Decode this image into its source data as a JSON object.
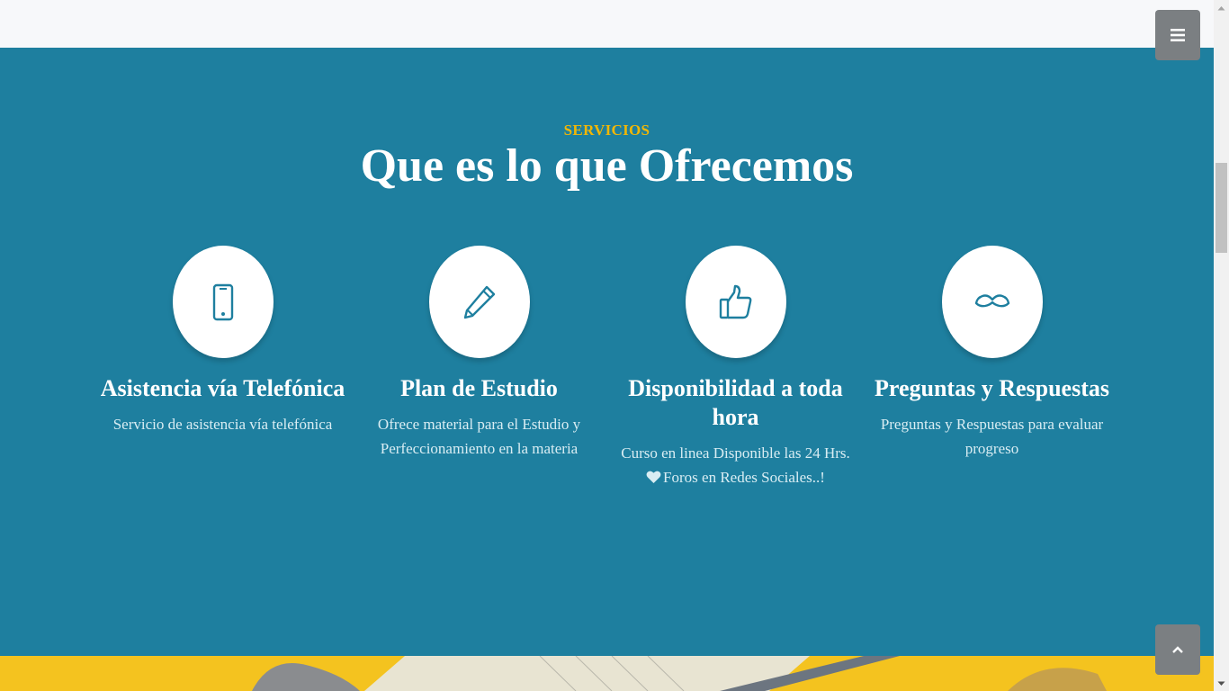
{
  "services": {
    "eyebrow": "SERVICIOS",
    "title": "Que es lo que Ofrecemos",
    "items": [
      {
        "icon": "mobile-phone-icon",
        "title": "Asistencia vía Telefónica",
        "lines": [
          "Servicio de asistencia vía telefónica"
        ]
      },
      {
        "icon": "pencil-icon",
        "title": "Plan de Estudio",
        "lines": [
          "Ofrece material para el Estudio y",
          "Perfeccionamiento en la materia"
        ]
      },
      {
        "icon": "thumbs-up-icon",
        "title_lines": [
          "Disponibilidad a toda",
          "hora"
        ],
        "lines": [
          "Curso en linea Disponible las 24 Hrs.",
          "Foros en Redes Sociales..!"
        ]
      },
      {
        "icon": "mustache-icon",
        "title": "Preguntas y Respuestas",
        "lines": [
          "Preguntas y Respuestas para evaluar",
          "progreso"
        ]
      }
    ]
  },
  "controls": {
    "menu_icon": "hamburger-menu-icon",
    "to_top_icon": "chevron-up-icon"
  },
  "colors": {
    "section_background": "#1e7f9f",
    "eyebrow": "#f2b705",
    "title_text": "#ffffff",
    "body_text": "#d9edf3",
    "icon_color": "#1e7f9f",
    "button_background": "#7b7f82"
  }
}
